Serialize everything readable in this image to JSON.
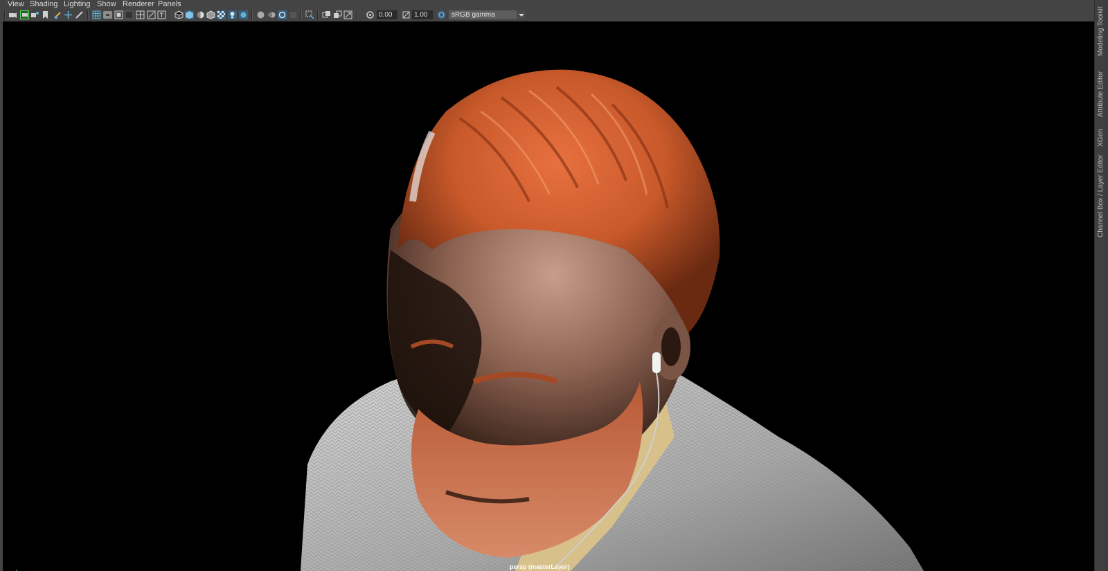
{
  "menubar": {
    "items": [
      {
        "label": "View"
      },
      {
        "label": "Shading"
      },
      {
        "label": "Lighting"
      },
      {
        "label": "Show"
      },
      {
        "label": "Renderer"
      },
      {
        "label": "Panels"
      }
    ]
  },
  "toolbar": {
    "exposure_value": "0.00",
    "gamma_value": "1.00",
    "color_space": "sRGB gamma",
    "icons": [
      "select-camera-icon",
      "camera-attributes-icon",
      "bookmarks-icon",
      "image-plane-icon",
      "grease-pencil-icon",
      "grid-icon",
      "film-gate-icon",
      "resolution-gate-icon",
      "gate-mask-icon",
      "field-chart-icon",
      "safe-action-icon",
      "safe-title-icon",
      "wireframe-icon",
      "smooth-shade-icon",
      "default-material-icon",
      "wireframe-on-shaded-icon",
      "textured-icon",
      "use-all-lights-icon",
      "shadows-icon",
      "ambient-occlusion-icon",
      "motion-blur-icon",
      "anti-aliasing-icon",
      "depth-of-field-icon",
      "isolate-select-icon",
      "xray-icon",
      "xray-joints-icon",
      "xray-active-components-icon",
      "exposure-icon",
      "gamma-icon",
      "color-management-icon"
    ]
  },
  "viewport": {
    "camera_label": "persp (masterLayer)",
    "scene_description": "3D render of a bearded man with copper-orange hair wearing a grey knit sweater and earphones"
  },
  "right_tabs": [
    {
      "label": "Modeling Toolkit"
    },
    {
      "label": "Attribute Editor"
    },
    {
      "label": "XGen"
    },
    {
      "label": "Channel Box / Layer Editor"
    }
  ],
  "colors": {
    "ui_bg": "#444444",
    "viewport_bg": "#000000",
    "active_icon": "#5fb3d9",
    "hair": "#c8592a",
    "sweater": "#b5b5b5"
  }
}
